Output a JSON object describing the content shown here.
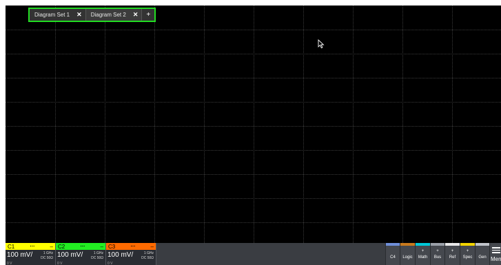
{
  "tabs": [
    {
      "label": "Diagram Set 1",
      "close": "✕"
    },
    {
      "label": "Diagram Set 2",
      "close": "✕"
    }
  ],
  "add_tab_label": "+",
  "channels": [
    {
      "name": "C1",
      "scale": "100 mV/",
      "bandwidth": "1 GHz",
      "coupling": "DC 50Ω",
      "offset": "0 V",
      "color": "#ffff00"
    },
    {
      "name": "C2",
      "scale": "100 mV/",
      "bandwidth": "1 GHz",
      "coupling": "DC 50Ω",
      "offset": "0 V",
      "color": "#22ee22"
    },
    {
      "name": "C3",
      "scale": "100 mV/",
      "bandwidth": "1 GHz",
      "coupling": "DC 50Ω",
      "offset": "0 V",
      "color": "#ff6a00"
    }
  ],
  "channel_indicator": "⋯",
  "channel_menu_glyph": "–",
  "right_buttons": [
    {
      "label": "C4",
      "plus": "",
      "color": "#6f8fd8"
    },
    {
      "label": "Logic",
      "plus": "",
      "color": "#c87a1e"
    },
    {
      "label": "Math",
      "plus": "+",
      "color": "#00c8d8"
    },
    {
      "label": "Bus",
      "plus": "+",
      "color": "#9aa0a8"
    },
    {
      "label": "Ref",
      "plus": "+",
      "color": "#e8e8e8"
    },
    {
      "label": "Spec",
      "plus": "+",
      "color": "#f2d400"
    },
    {
      "label": "Gen",
      "plus": "",
      "color": "#c0c4ca"
    }
  ],
  "menu_label": "Menu"
}
